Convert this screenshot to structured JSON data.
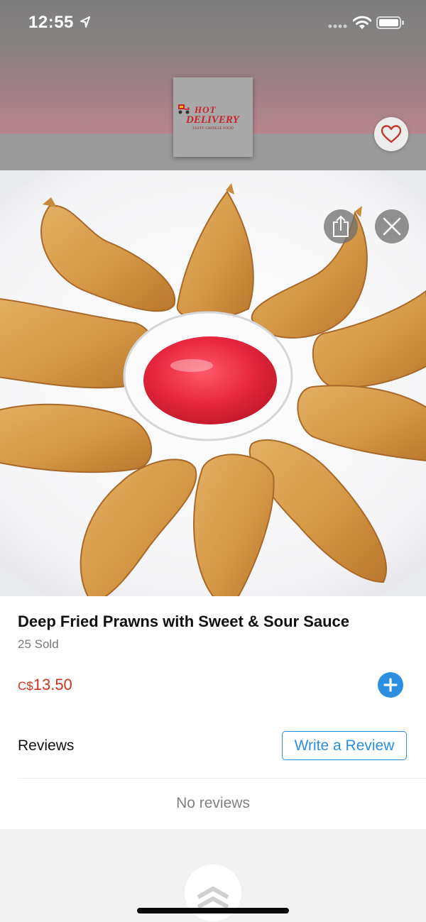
{
  "status_bar": {
    "time": "12:55"
  },
  "restaurant": {
    "logo_line_1": "HOT",
    "logo_line_2": "DELIVERY",
    "logo_tagline": "TASTY CHINESE FOOD"
  },
  "item": {
    "title": "Deep Fried Prawns with Sweet & Sour Sauce",
    "sold": "25 Sold",
    "price_currency": "C$",
    "price_amount": "13.50"
  },
  "reviews": {
    "label": "Reviews",
    "write_button": "Write a Review",
    "empty_text": "No reviews"
  },
  "icons": {
    "favorite": "heart-icon",
    "share": "share-icon",
    "close": "close-icon",
    "add": "plus-icon",
    "scroll_up": "chevrons-up-icon"
  },
  "colors": {
    "accent_blue": "#2d8fe0",
    "price_red": "#d0331e",
    "heart_red": "#c0392b"
  }
}
